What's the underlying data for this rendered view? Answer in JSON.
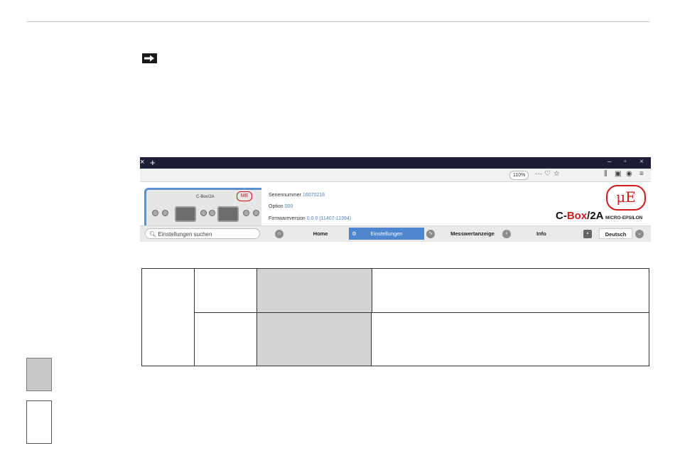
{
  "browser": {
    "tab_close": "×",
    "new_tab": "+",
    "window_controls": [
      "–",
      "▫",
      "×"
    ],
    "zoom_level": "110%",
    "url_icons": [
      "more-icon",
      "pocket-icon",
      "star-icon"
    ],
    "toolbar_icons": [
      "library-icon",
      "sidebar-icon",
      "account-icon",
      "menu-icon"
    ]
  },
  "device": {
    "label": "C-Box/2A",
    "logo": "ME"
  },
  "info": {
    "serial_label": "Seriennummer",
    "serial_value": "16070218",
    "option_label": "Option",
    "option_value": "000",
    "firmware_label": "Firmwareversion",
    "firmware_value": "0.0.0 (11407-11394)"
  },
  "brand": {
    "prefix": "C-",
    "accent": "Box",
    "suffix": "/2A",
    "logo_mark": "μE",
    "logo_text": "MICRO-EPSILON",
    "accent_color": "#d01b1b"
  },
  "nav": {
    "search_placeholder": "Einstellungen suchen",
    "home": "Home",
    "settings": "Einstellungen",
    "measure": "Messwertanzeige",
    "info": "Info",
    "language": "Deutsch",
    "active_color": "#4e86cf"
  }
}
